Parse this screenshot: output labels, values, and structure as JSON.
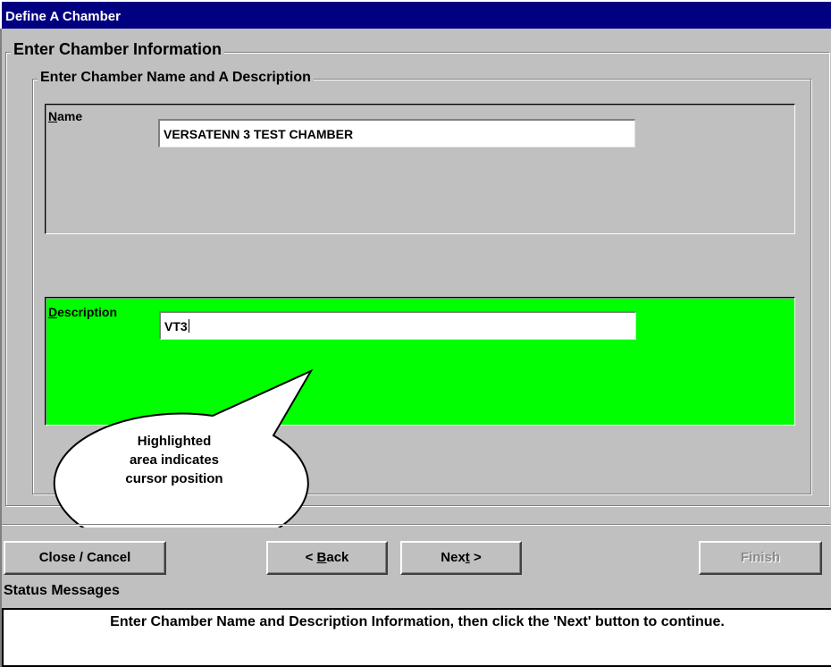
{
  "window": {
    "title": "Define A Chamber"
  },
  "group_outer": {
    "label": "Enter Chamber Information"
  },
  "group_inner": {
    "label": "Enter Chamber Name and A Description"
  },
  "name_field": {
    "label_hotkey": "N",
    "label_rest": "ame",
    "value": "VERSATENN 3 TEST CHAMBER"
  },
  "description_field": {
    "label_hotkey": "D",
    "label_rest": "escription",
    "value": "VT3",
    "highlight_color": "#00ff00"
  },
  "callout": {
    "lines": [
      "Highlighted",
      "area indicates",
      "cursor position"
    ]
  },
  "buttons": {
    "close": "Close / Cancel",
    "back_prefix": "< ",
    "back_hotkey": "B",
    "back_rest": "ack",
    "next_prefix": "Nex",
    "next_hotkey": "t",
    "next_suffix": " >",
    "finish": "Finish"
  },
  "status": {
    "label": "Status Messages",
    "message": "Enter Chamber Name and Description Information, then click the 'Next' button to continue."
  },
  "colors": {
    "titlebar": "#000080",
    "face": "#c0c0c0",
    "highlight": "#00ff00"
  }
}
